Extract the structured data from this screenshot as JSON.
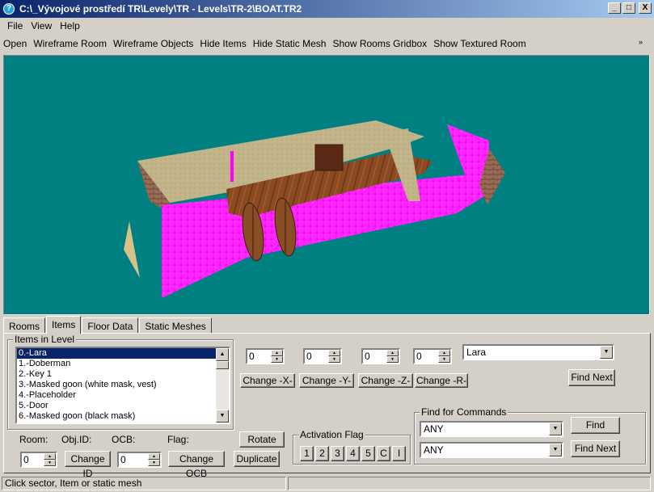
{
  "window": {
    "title": "C:\\_Vývojové prostředí TR\\Levely\\TR - Levels\\TR-2\\BOAT.TR2",
    "minimize": "_",
    "maximize": "□",
    "close": "X"
  },
  "menu": {
    "file": "File",
    "view": "View",
    "help": "Help"
  },
  "toolbar": {
    "open": "Open",
    "wireframe_room": "Wireframe Room",
    "wireframe_objects": "Wireframe Objects",
    "hide_items": "Hide Items",
    "hide_static_mesh": "Hide Static Mesh",
    "show_rooms_gridbox": "Show Rooms Gridbox",
    "show_textured_room": "Show Textured Room",
    "more": "»"
  },
  "tabs": [
    "Rooms",
    "Items",
    "Floor Data",
    "Static Meshes"
  ],
  "items_group": {
    "title": "Items in Level",
    "items": [
      "0.-Lara",
      "1.-Doberman",
      "2.-Key 1",
      "3.-Masked goon (white mask, vest)",
      "4.-Placeholder",
      "5.-Door",
      "6.-Masked goon (black mask)"
    ],
    "selected_index": 0
  },
  "info_labels": {
    "room": "Room:",
    "obj_id": "Obj.ID:",
    "ocb": "OCB:",
    "flag": "Flag:"
  },
  "coords": {
    "x": "0",
    "y": "0",
    "z": "0",
    "r": "0",
    "change_x": "Change -X-",
    "change_y": "Change -Y-",
    "change_z": "Change -Z-",
    "change_r": "Change -R-"
  },
  "bottom": {
    "id_value": "0",
    "change_id": "Change ID",
    "ocb_value": "0",
    "change_ocb": "Change OCB",
    "duplicate": "Duplicate",
    "rotate": "Rotate"
  },
  "activation": {
    "title": "Activation Flag",
    "flags": [
      "1",
      "2",
      "3",
      "4",
      "5",
      "C",
      "I"
    ]
  },
  "search": {
    "item_value": "Lara",
    "find_next": "Find Next"
  },
  "commands": {
    "title": "Find for Commands",
    "combo1": "ANY",
    "combo2": "ANY",
    "find": "Find",
    "find_next": "Find Next"
  },
  "status": {
    "message": "Click sector, Item or static mesh",
    "secondary": ""
  },
  "colors": {
    "water": "#ff22ff",
    "viewport": "#008080",
    "floor": "#c2b489",
    "wood": "#8b4a22"
  }
}
